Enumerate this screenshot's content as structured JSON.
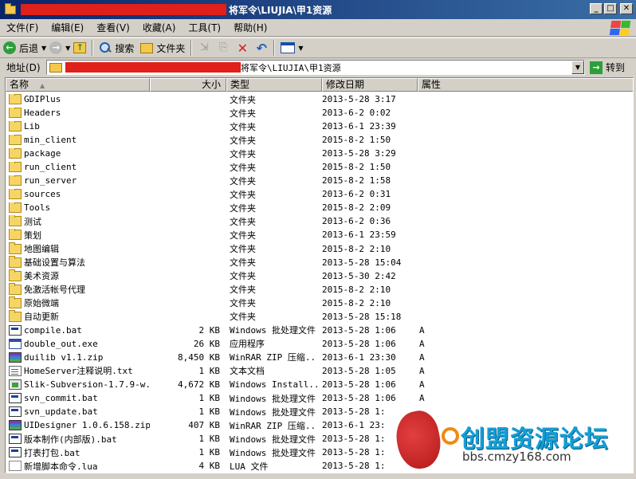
{
  "window": {
    "title": "将军令\\LIUJIA\\甲1资源",
    "controls": {
      "minimize": "_",
      "maximize": "□",
      "close": "✕"
    }
  },
  "menu": [
    "文件(F)",
    "编辑(E)",
    "查看(V)",
    "收藏(A)",
    "工具(T)",
    "帮助(H)"
  ],
  "toolbar": {
    "back_label": "后退",
    "search_label": "搜索",
    "folders_label": "文件夹"
  },
  "address": {
    "label": "地址(D)",
    "path": "将军令\\LIUJIA\\甲1资源",
    "go_label": "转到"
  },
  "columns": {
    "name": "名称",
    "size": "大小",
    "type": "类型",
    "modified": "修改日期",
    "attributes": "属性"
  },
  "files": [
    {
      "name": "GDIPlus",
      "size": "",
      "type": "文件夹",
      "modified": "2013-5-28 3:17",
      "attr": "",
      "icon": "folder-icon"
    },
    {
      "name": "Headers",
      "size": "",
      "type": "文件夹",
      "modified": "2013-6-2 0:02",
      "attr": "",
      "icon": "folder-icon"
    },
    {
      "name": "Lib",
      "size": "",
      "type": "文件夹",
      "modified": "2013-6-1 23:39",
      "attr": "",
      "icon": "folder-icon"
    },
    {
      "name": "min_client",
      "size": "",
      "type": "文件夹",
      "modified": "2015-8-2 1:50",
      "attr": "",
      "icon": "folder-icon"
    },
    {
      "name": "package",
      "size": "",
      "type": "文件夹",
      "modified": "2013-5-28 3:29",
      "attr": "",
      "icon": "folder-icon"
    },
    {
      "name": "run_client",
      "size": "",
      "type": "文件夹",
      "modified": "2015-8-2 1:50",
      "attr": "",
      "icon": "folder-icon"
    },
    {
      "name": "run_server",
      "size": "",
      "type": "文件夹",
      "modified": "2015-8-2 1:58",
      "attr": "",
      "icon": "folder-icon"
    },
    {
      "name": "sources",
      "size": "",
      "type": "文件夹",
      "modified": "2013-6-2 0:31",
      "attr": "",
      "icon": "folder-icon"
    },
    {
      "name": "Tools",
      "size": "",
      "type": "文件夹",
      "modified": "2015-8-2 2:09",
      "attr": "",
      "icon": "folder-icon"
    },
    {
      "name": "测试",
      "size": "",
      "type": "文件夹",
      "modified": "2013-6-2 0:36",
      "attr": "",
      "icon": "folder-icon"
    },
    {
      "name": "策划",
      "size": "",
      "type": "文件夹",
      "modified": "2013-6-1 23:59",
      "attr": "",
      "icon": "folder-icon"
    },
    {
      "name": "地图编辑",
      "size": "",
      "type": "文件夹",
      "modified": "2015-8-2 2:10",
      "attr": "",
      "icon": "folder-icon"
    },
    {
      "name": "基础设置与算法",
      "size": "",
      "type": "文件夹",
      "modified": "2013-5-28 15:04",
      "attr": "",
      "icon": "folder-icon"
    },
    {
      "name": "美术资源",
      "size": "",
      "type": "文件夹",
      "modified": "2013-5-30 2:42",
      "attr": "",
      "icon": "folder-icon"
    },
    {
      "name": "免激活帐号代理",
      "size": "",
      "type": "文件夹",
      "modified": "2015-8-2 2:10",
      "attr": "",
      "icon": "folder-icon"
    },
    {
      "name": "原始微端",
      "size": "",
      "type": "文件夹",
      "modified": "2015-8-2 2:10",
      "attr": "",
      "icon": "folder-icon"
    },
    {
      "name": "自动更新",
      "size": "",
      "type": "文件夹",
      "modified": "2013-5-28 15:18",
      "attr": "",
      "icon": "folder-icon"
    },
    {
      "name": "compile.bat",
      "size": "2 KB",
      "type": "Windows 批处理文件",
      "modified": "2013-5-28 1:06",
      "attr": "A",
      "icon": "batch-file-icon"
    },
    {
      "name": "double_out.exe",
      "size": "26 KB",
      "type": "应用程序",
      "modified": "2013-5-28 1:06",
      "attr": "A",
      "icon": "exe-file-icon"
    },
    {
      "name": "duilib v1.1.zip",
      "size": "8,450 KB",
      "type": "WinRAR ZIP 压缩...",
      "modified": "2013-6-1 23:30",
      "attr": "A",
      "icon": "zip-file-icon"
    },
    {
      "name": "HomeServer注释说明.txt",
      "size": "1 KB",
      "type": "文本文档",
      "modified": "2013-5-28 1:05",
      "attr": "A",
      "icon": "text-file-icon"
    },
    {
      "name": "Slik-Subversion-1.7.9-w...",
      "size": "4,672 KB",
      "type": "Windows Install...",
      "modified": "2013-5-28 1:06",
      "attr": "A",
      "icon": "msi-file-icon"
    },
    {
      "name": "svn_commit.bat",
      "size": "1 KB",
      "type": "Windows 批处理文件",
      "modified": "2013-5-28 1:06",
      "attr": "A",
      "icon": "batch-file-icon"
    },
    {
      "name": "svn_update.bat",
      "size": "1 KB",
      "type": "Windows 批处理文件",
      "modified": "2013-5-28 1:",
      "attr": "",
      "icon": "batch-file-icon"
    },
    {
      "name": "UIDesigner 1.0.6.158.zip",
      "size": "407 KB",
      "type": "WinRAR ZIP 压缩...",
      "modified": "2013-6-1 23:",
      "attr": "",
      "icon": "zip-file-icon"
    },
    {
      "name": "版本制作(内部版).bat",
      "size": "1 KB",
      "type": "Windows 批处理文件",
      "modified": "2013-5-28 1:",
      "attr": "",
      "icon": "batch-file-icon"
    },
    {
      "name": "打表打包.bat",
      "size": "1 KB",
      "type": "Windows 批处理文件",
      "modified": "2013-5-28 1:",
      "attr": "",
      "icon": "batch-file-icon"
    },
    {
      "name": "新增脚本命令.lua",
      "size": "4 KB",
      "type": "LUA 文件",
      "modified": "2013-5-28 1:",
      "attr": "",
      "icon": "lua-file-icon"
    }
  ],
  "watermark": {
    "title": "创盟资源论坛",
    "url": "bbs.cmzy168.com"
  }
}
